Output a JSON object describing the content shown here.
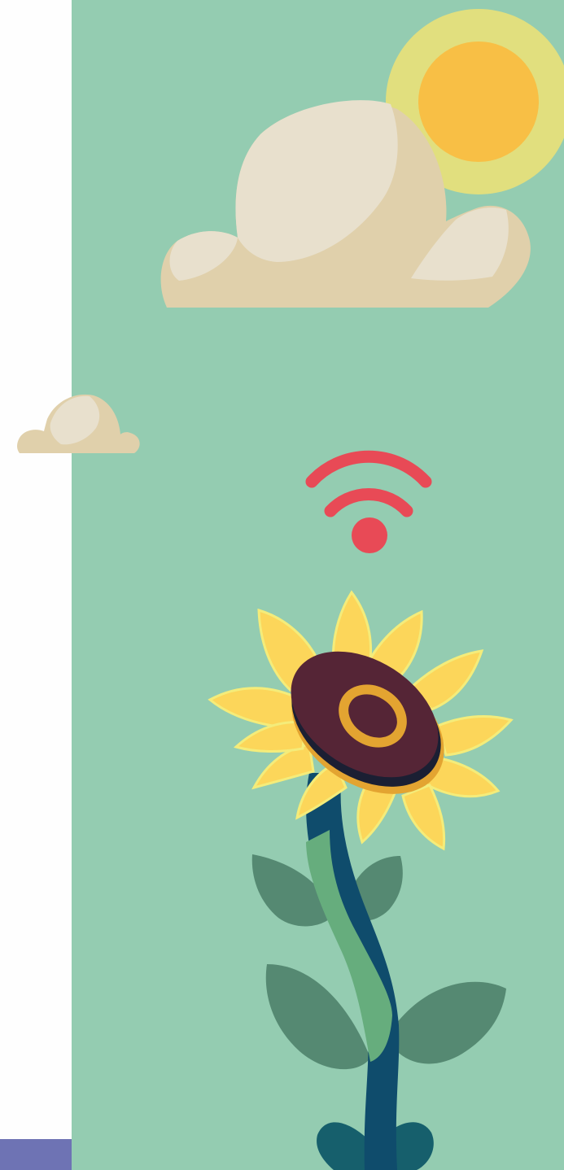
{
  "colors": {
    "panel_background": "#94ccb1",
    "left_panel": "#fefefe",
    "left_accent": "#6e73b4",
    "sun_halo": "#e1df7e",
    "sun": "#f8bf45",
    "cloud_light": "#e8e0cd",
    "cloud_shade": "#e0d0ab",
    "wifi": "#e84a56",
    "petal": "#fcd65a",
    "petal_light": "#f4ec7a",
    "flower_center": "#552536",
    "flower_ring": "#e3a431",
    "stem": "#66ad7d",
    "stem_dark": "#0f4c6c",
    "leaf": "#558972",
    "base": "#165f6c"
  },
  "icons": [
    "sun-icon",
    "cloud-icon",
    "wifi-icon",
    "sunflower-icon"
  ]
}
